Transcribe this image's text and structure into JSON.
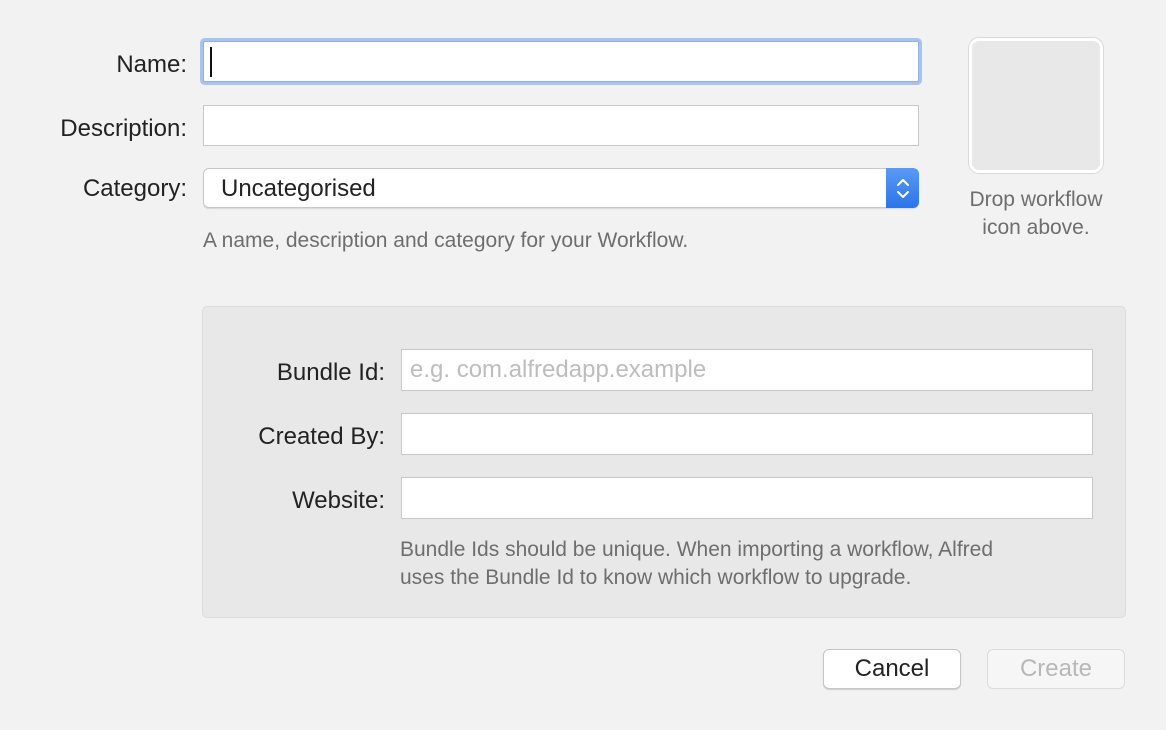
{
  "general": {
    "name_label": "Name:",
    "name_value": "",
    "description_label": "Description:",
    "description_value": "",
    "category_label": "Category:",
    "category_selected": "Uncategorised",
    "hint": "A name, description and category for your Workflow."
  },
  "icon_well": {
    "hint_line1": "Drop workflow",
    "hint_line2": "icon above."
  },
  "details": {
    "bundle_id_label": "Bundle Id:",
    "bundle_id_placeholder": "e.g. com.alfredapp.example",
    "bundle_id_value": "",
    "created_by_label": "Created By:",
    "created_by_value": "",
    "website_label": "Website:",
    "website_value": "",
    "hint_line1": "Bundle Ids should be unique. When importing a workflow, Alfred",
    "hint_line2": "uses the Bundle Id to know which workflow to upgrade."
  },
  "buttons": {
    "cancel_label": "Cancel",
    "create_label": "Create"
  },
  "colors": {
    "background": "#f2f2f2",
    "focus_ring": "#a8c3ee",
    "select_accent": "#2c74e8",
    "panel": "#e8e8e8"
  },
  "icons": {
    "select_arrows": "chevron-up-down-icon"
  }
}
